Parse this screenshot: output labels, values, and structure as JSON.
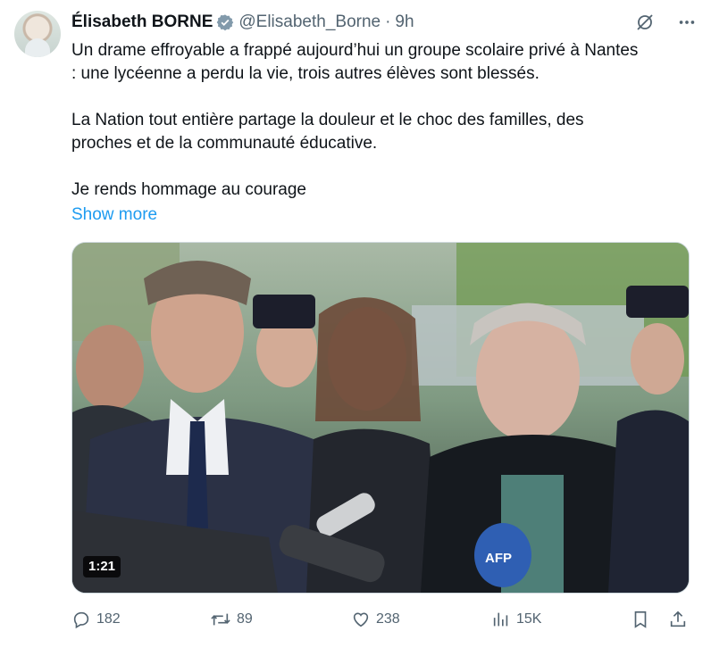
{
  "tweet": {
    "author": "Élisabeth BORNE",
    "handle": "@Elisabeth_Borne",
    "separator": "·",
    "time": "9h",
    "text": "Un drame effroyable a frappé aujourd’hui un groupe scolaire privé à Nantes\n: une lycéenne a perdu la vie, trois autres élèves sont blessés.\n\nLa Nation tout entière partage la douleur et le choc des familles, des\nproches et de la communauté éducative.\n\nJe rends hommage au courage",
    "show_more": "Show more"
  },
  "media": {
    "duration": "1:21",
    "mic_label": "AFP"
  },
  "icons": {
    "verified": "verified-badge-icon",
    "grok": "grok-icon",
    "more": "more-options-icon",
    "reply": "reply-icon",
    "retweet": "retweet-icon",
    "like": "like-icon",
    "views": "views-icon",
    "bookmark": "bookmark-icon",
    "share": "share-icon"
  },
  "colors": {
    "accent": "#1d9bf0",
    "text": "#0f1419",
    "muted": "#536471",
    "border": "#cfd9de"
  },
  "actions": {
    "reply_count": "182",
    "retweet_count": "89",
    "like_count": "238",
    "view_count": "15K"
  }
}
